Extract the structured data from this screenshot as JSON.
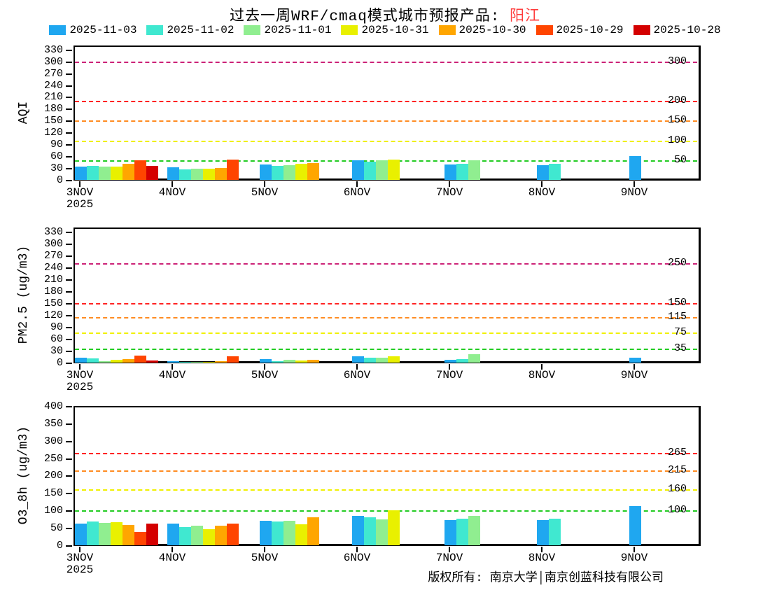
{
  "title": {
    "prefix": "过去一周WRF/cmaq模式城市预报产品: ",
    "city": "阳江"
  },
  "legend": [
    {
      "label": "2025-11-03",
      "color": "#1fa7f0"
    },
    {
      "label": "2025-11-02",
      "color": "#40e8d0"
    },
    {
      "label": "2025-11-01",
      "color": "#90ee90"
    },
    {
      "label": "2025-10-31",
      "color": "#e9f000"
    },
    {
      "label": "2025-10-30",
      "color": "#ffa600"
    },
    {
      "label": "2025-10-29",
      "color": "#ff4500"
    },
    {
      "label": "2025-10-28",
      "color": "#d40000"
    }
  ],
  "copyright": "版权所有: 南京大学│南京创蓝科技有限公司",
  "chart_data": [
    {
      "type": "bar",
      "title": "",
      "xlabel": "",
      "ylabel": "AQI",
      "ylim": [
        0,
        330
      ],
      "ytick_step": 30,
      "grid": false,
      "legend_position": "top",
      "categories": [
        "3NOV",
        "4NOV",
        "5NOV",
        "6NOV",
        "7NOV",
        "8NOV",
        "9NOV"
      ],
      "year_sublabel": "2025",
      "series": [
        {
          "name": "2025-11-03",
          "values": [
            33,
            32,
            39,
            50,
            39,
            37,
            61
          ]
        },
        {
          "name": "2025-11-02",
          "values": [
            36,
            26,
            35,
            46,
            41,
            40,
            null
          ]
        },
        {
          "name": "2025-11-01",
          "values": [
            33,
            28,
            37,
            49,
            49,
            null,
            null
          ]
        },
        {
          "name": "2025-10-31",
          "values": [
            33,
            28,
            40,
            51,
            null,
            null,
            null
          ]
        },
        {
          "name": "2025-10-30",
          "values": [
            40,
            30,
            42,
            null,
            null,
            null,
            null
          ]
        },
        {
          "name": "2025-10-29",
          "values": [
            50,
            52,
            null,
            null,
            null,
            null,
            null
          ]
        },
        {
          "name": "2025-10-28",
          "values": [
            35,
            null,
            null,
            null,
            null,
            null,
            null
          ]
        }
      ],
      "thresholds": [
        {
          "value": 50,
          "color": "#22cc22",
          "label": "50"
        },
        {
          "value": 100,
          "color": "#f0f000",
          "label": "100"
        },
        {
          "value": 150,
          "color": "#ff8c22",
          "label": "150"
        },
        {
          "value": 200,
          "color": "#ff2222",
          "label": "200"
        },
        {
          "value": 300,
          "color": "#cc2277",
          "label": "300"
        }
      ]
    },
    {
      "type": "bar",
      "title": "",
      "xlabel": "",
      "ylabel": "PM2.5 (ug/m3)",
      "ylim": [
        0,
        330
      ],
      "ytick_step": 30,
      "grid": false,
      "legend_position": "top",
      "categories": [
        "3NOV",
        "4NOV",
        "5NOV",
        "6NOV",
        "7NOV",
        "8NOV",
        "9NOV"
      ],
      "year_sublabel": "2025",
      "series": [
        {
          "name": "2025-11-03",
          "values": [
            13,
            3,
            9,
            16,
            7,
            0,
            12
          ]
        },
        {
          "name": "2025-11-02",
          "values": [
            10,
            2,
            4,
            12,
            9,
            0,
            null
          ]
        },
        {
          "name": "2025-11-01",
          "values": [
            4,
            2,
            7,
            12,
            21,
            null,
            null
          ]
        },
        {
          "name": "2025-10-31",
          "values": [
            7,
            2,
            5,
            15,
            null,
            null,
            null
          ]
        },
        {
          "name": "2025-10-30",
          "values": [
            9,
            4,
            7,
            null,
            null,
            null,
            null
          ]
        },
        {
          "name": "2025-10-29",
          "values": [
            18,
            15,
            null,
            null,
            null,
            null,
            null
          ]
        },
        {
          "name": "2025-10-28",
          "values": [
            6,
            null,
            null,
            null,
            null,
            null,
            null
          ]
        }
      ],
      "thresholds": [
        {
          "value": 35,
          "color": "#22cc22",
          "label": "35"
        },
        {
          "value": 75,
          "color": "#f0f000",
          "label": "75"
        },
        {
          "value": 115,
          "color": "#ff8c22",
          "label": "115"
        },
        {
          "value": 150,
          "color": "#ff2222",
          "label": "150"
        },
        {
          "value": 250,
          "color": "#cc2277",
          "label": "250"
        }
      ]
    },
    {
      "type": "bar",
      "title": "",
      "xlabel": "",
      "ylabel": "O3_8h (ug/m3)",
      "ylim": [
        0,
        400
      ],
      "ytick_step": 50,
      "grid": false,
      "legend_position": "top",
      "categories": [
        "3NOV",
        "4NOV",
        "5NOV",
        "6NOV",
        "7NOV",
        "8NOV",
        "9NOV"
      ],
      "year_sublabel": "2025",
      "series": [
        {
          "name": "2025-11-03",
          "values": [
            62,
            62,
            71,
            84,
            73,
            73,
            112
          ]
        },
        {
          "name": "2025-11-02",
          "values": [
            69,
            52,
            68,
            80,
            77,
            77,
            null
          ]
        },
        {
          "name": "2025-11-01",
          "values": [
            65,
            56,
            71,
            75,
            84,
            null,
            null
          ]
        },
        {
          "name": "2025-10-31",
          "values": [
            67,
            46,
            61,
            100,
            null,
            null,
            null
          ]
        },
        {
          "name": "2025-10-30",
          "values": [
            58,
            57,
            80,
            null,
            null,
            null,
            null
          ]
        },
        {
          "name": "2025-10-29",
          "values": [
            38,
            62,
            null,
            null,
            null,
            null,
            null
          ]
        },
        {
          "name": "2025-10-28",
          "values": [
            62,
            null,
            null,
            null,
            null,
            null,
            null
          ]
        }
      ],
      "thresholds": [
        {
          "value": 100,
          "color": "#22cc22",
          "label": "100"
        },
        {
          "value": 160,
          "color": "#f0f000",
          "label": "160"
        },
        {
          "value": 215,
          "color": "#ff8c22",
          "label": "215"
        },
        {
          "value": 265,
          "color": "#ff2222",
          "label": "265"
        }
      ]
    }
  ]
}
